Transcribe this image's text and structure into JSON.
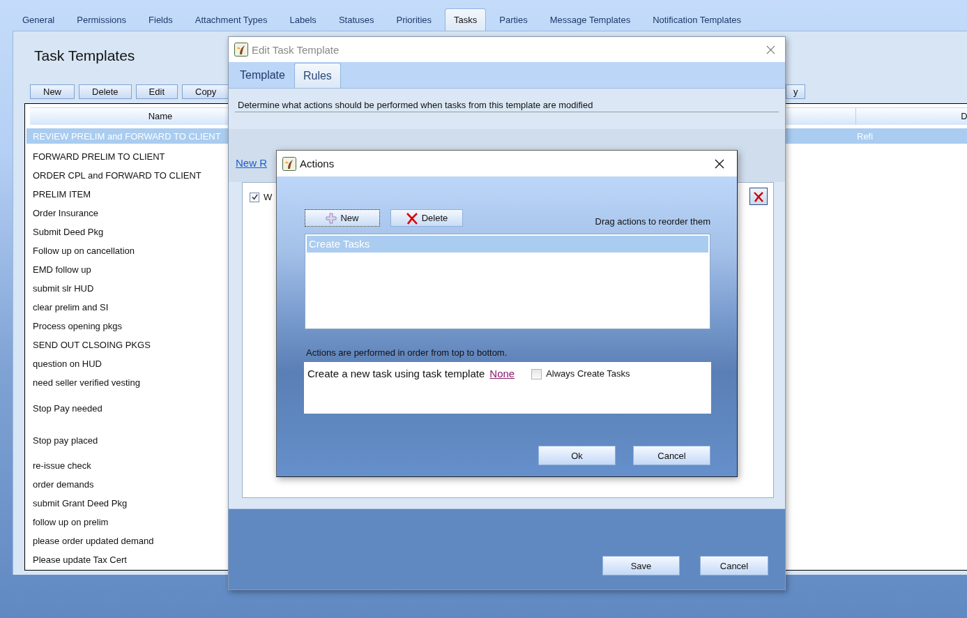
{
  "top_tabs": [
    {
      "label": "General",
      "selected": false
    },
    {
      "label": "Permissions",
      "selected": false
    },
    {
      "label": "Fields",
      "selected": false
    },
    {
      "label": "Attachment Types",
      "selected": false
    },
    {
      "label": "Labels",
      "selected": false
    },
    {
      "label": "Statuses",
      "selected": false
    },
    {
      "label": "Priorities",
      "selected": false
    },
    {
      "label": "Tasks",
      "selected": true
    },
    {
      "label": "Parties",
      "selected": false
    },
    {
      "label": "Message Templates",
      "selected": false
    },
    {
      "label": "Notification Templates",
      "selected": false
    }
  ],
  "page": {
    "title": "Task Templates",
    "toolbar": [
      "New",
      "Delete",
      "Edit",
      "Copy",
      "y"
    ]
  },
  "table": {
    "columns": [
      "Name",
      "D"
    ],
    "rows": [
      {
        "name": "REVIEW PRELIM and FORWARD TO CLIENT",
        "col_2": "Refi",
        "selected": true
      },
      {
        "name": "FORWARD PRELIM TO CLIENT",
        "selected": false
      },
      {
        "name": "ORDER CPL  and FORWARD TO CLIENT",
        "selected": false
      },
      {
        "name": "PRELIM ITEM",
        "selected": false
      },
      {
        "name": "Order Insurance",
        "selected": false
      },
      {
        "name": "Submit Deed Pkg",
        "selected": false
      },
      {
        "name": "Follow up on cancellation",
        "selected": false
      },
      {
        "name": "EMD follow up",
        "selected": false
      },
      {
        "name": "submit slr HUD",
        "selected": false
      },
      {
        "name": "clear prelim and SI",
        "selected": false
      },
      {
        "name": "Process opening pkgs",
        "selected": false
      },
      {
        "name": "SEND OUT CLSOING PKGS",
        "selected": false
      },
      {
        "name": "question on HUD",
        "selected": false
      },
      {
        "name": "need seller verified vesting",
        "selected": false
      },
      {
        "name": "Stop Pay needed",
        "selected": false
      },
      {
        "name": "Stop pay placed",
        "selected": false
      },
      {
        "name": "re-issue check",
        "selected": false
      },
      {
        "name": "order demands",
        "selected": false
      },
      {
        "name": "submit Grant Deed Pkg",
        "selected": false
      },
      {
        "name": "follow up on prelim",
        "selected": false
      },
      {
        "name": "please order updated demand",
        "selected": false
      },
      {
        "name": "Please update Tax Cert",
        "selected": false
      }
    ]
  },
  "edit_dialog": {
    "title": "Edit Task Template",
    "tabs": [
      {
        "label": "Template",
        "selected": false
      },
      {
        "label": "Rules",
        "selected": true
      }
    ],
    "description": "Determine what actions should be performed when tasks from this template are modified",
    "new_rule_link": "New R",
    "rule": {
      "checked": true,
      "label": "W"
    },
    "buttons": [
      "Save",
      "Cancel"
    ]
  },
  "actions_dialog": {
    "title": "Actions",
    "toolbar": [
      {
        "kind": "new",
        "label": "New",
        "focused": true
      },
      {
        "kind": "delete",
        "label": "Delete",
        "focused": false
      }
    ],
    "hint": "Drag actions to reorder them",
    "actions": [
      {
        "label": "Create Tasks",
        "selected": true
      }
    ],
    "order_note": "Actions are performed in order from top to bottom.",
    "detail": {
      "text": "Create a new task using task template",
      "link": "None",
      "always_create": {
        "label": "Always Create Tasks",
        "checked": false
      }
    },
    "buttons": [
      "Ok",
      "Cancel"
    ]
  }
}
